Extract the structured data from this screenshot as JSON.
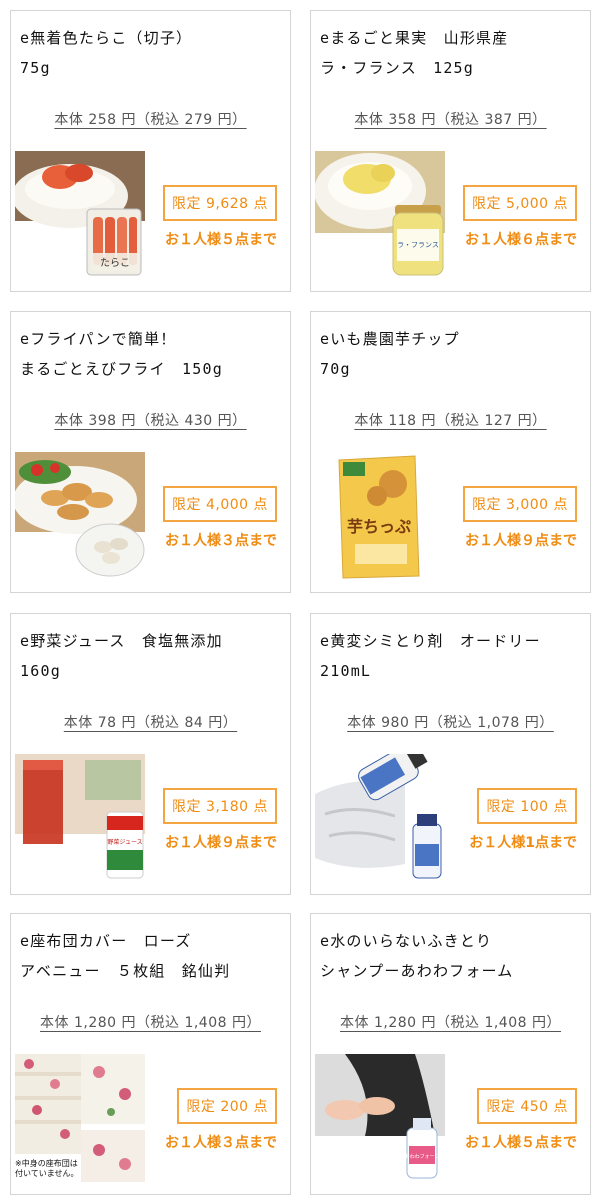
{
  "products": [
    {
      "name_line1": "e無着色たらこ（切子）",
      "name_line2": "75g",
      "price": "本体 258 円（税込 279 円）",
      "limit": "限定 9,628 点",
      "per_person": "お１人様５点まで",
      "image_icon": "tarako-rice-photo",
      "package_text": "たらこ"
    },
    {
      "name_line1": "eまるごと果実　山形県産",
      "name_line2": "ラ・フランス　125g",
      "price": "本体 358 円（税込 387 円）",
      "limit": "限定 5,000 点",
      "per_person": "お１人様６点まで",
      "image_icon": "la-france-jar-photo",
      "package_text": "ラ・フランス"
    },
    {
      "name_line1": "eフライパンで簡単！",
      "name_line2": "まるごとえびフライ　150g",
      "price": "本体 398 円（税込 430 円）",
      "limit": "限定 4,000 点",
      "per_person": "お１人様３点まで",
      "image_icon": "fried-shrimp-photo",
      "package_text": ""
    },
    {
      "name_line1": "eいも農園芋チップ",
      "name_line2": "70g",
      "price": "本体 118 円（税込 127 円）",
      "limit": "限定 3,000 点",
      "per_person": "お１人様９点まで",
      "image_icon": "potato-chips-bag-photo",
      "package_text": "芋ちっぷ"
    },
    {
      "name_line1": "e野菜ジュース　食塩無添加",
      "name_line2": "160g",
      "price": "本体 78 円（税込 84 円）",
      "limit": "限定 3,180 点",
      "per_person": "お１人様９点まで",
      "image_icon": "vegetable-juice-photo",
      "package_text": "野菜ジュース"
    },
    {
      "name_line1": "e黄変シミとり剤　オードリー",
      "name_line2": "210mL",
      "price": "本体 980 円（税込 1,078 円）",
      "limit": "限定 100 点",
      "per_person": "お１人様1点まで",
      "image_icon": "stain-remover-bottle-photo",
      "package_text": ""
    },
    {
      "name_line1": "e座布団カバー　ローズ",
      "name_line2": "アベニュー　５枚組　銘仙判",
      "price": "本体 1,280 円（税込 1,408 円）",
      "limit": "限定 200 点",
      "per_person": "お１人様３点まで",
      "image_icon": "rose-cushion-cover-photo",
      "package_text": "",
      "note_line1": "※中身の座布団は",
      "note_line2": "付いていません。"
    },
    {
      "name_line1": "e水のいらないふきとり",
      "name_line2": "シャンプーあわわフォーム",
      "price": "本体 1,280 円（税込 1,408 円）",
      "limit": "限定 450 点",
      "per_person": "お１人様５点まで",
      "image_icon": "foam-shampoo-photo",
      "package_text": "あわわフォーム"
    }
  ],
  "colors": {
    "accent": "#f08c12",
    "border_accent": "#f2a541",
    "card_border": "#d4d4d4"
  }
}
